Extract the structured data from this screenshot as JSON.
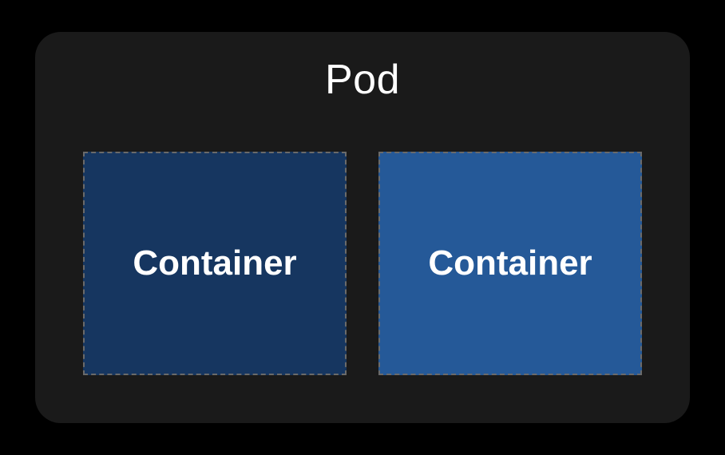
{
  "pod": {
    "title": "Pod",
    "containers": [
      {
        "label": "Container",
        "shade": "dark"
      },
      {
        "label": "Container",
        "shade": "light"
      }
    ]
  }
}
